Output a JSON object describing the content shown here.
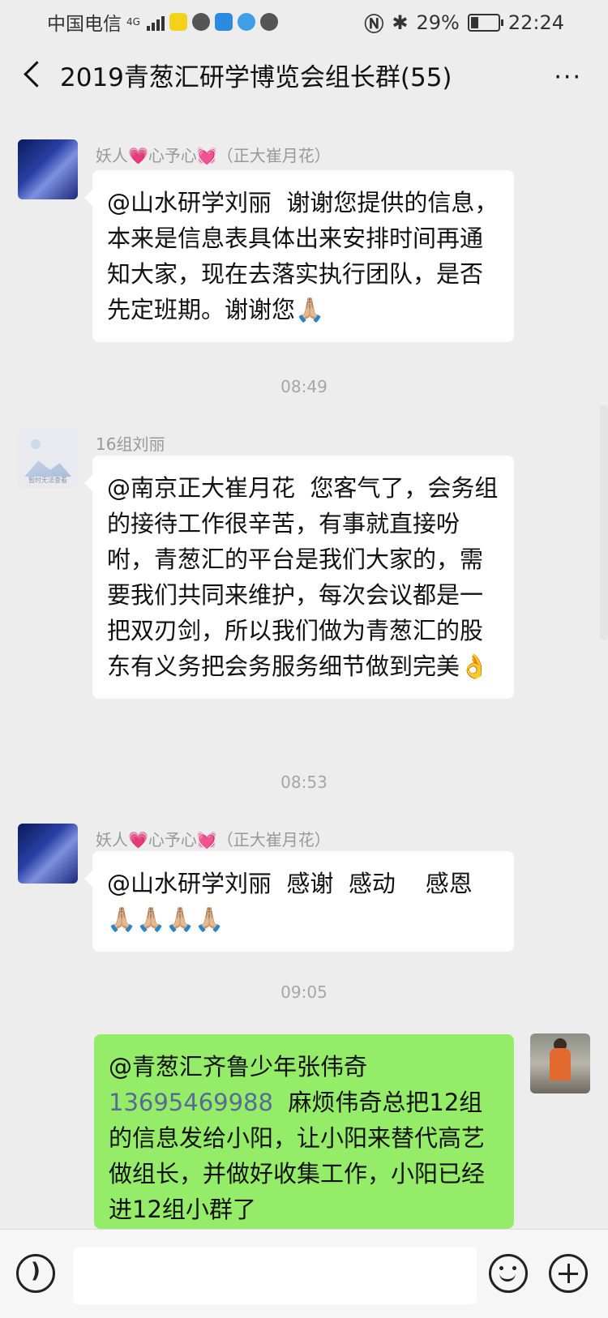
{
  "status_bar": {
    "carrier": "中国电信",
    "network": "4G",
    "battery_percent": "29%",
    "time": "22:24"
  },
  "header": {
    "title": "2019青葱汇研学博览会组长群(55)",
    "more_label": "···"
  },
  "messages": [
    {
      "sender": "妖人💗心予心💓（正大崔月花）",
      "text": "@山水研学刘丽  谢谢您提供的信息，本来是信息表具体出来安排时间再通知大家，现在去落实执行团队，是否先定班期。谢谢您🙏🏼",
      "side": "left",
      "avatar": "landscape-icon"
    },
    {
      "time": "08:49"
    },
    {
      "sender": "16组刘丽",
      "avatar_caption": "暂时无法查看",
      "text": "@南京正大崔月花  您客气了，会务组的接待工作很辛苦，有事就直接吩咐，青葱汇的平台是我们大家的，需要我们共同来维护，每次会议都是一把双刃剑，所以我们做为青葱汇的股东有义务把会务服务细节做到完美👌",
      "side": "left"
    },
    {
      "time": "08:53"
    },
    {
      "sender": "妖人💗心予心💓（正大崔月花）",
      "text": "@山水研学刘丽  感谢  感动    感恩🙏🏼🙏🏼🙏🏼🙏🏼",
      "side": "left"
    },
    {
      "time": "09:05"
    },
    {
      "text_before": "@青葱汇齐鲁少年张伟奇 ",
      "phone": "13695469988",
      "text_after": "  麻烦伟奇总把12组的信息发给小阳，让小阳来替代高艺做组长，并做好收集工作，小阳已经进12组小群了",
      "side": "right"
    }
  ],
  "input_bar": {
    "placeholder": "",
    "voice_icon": "voice-icon",
    "emoji_icon": "emoji-icon",
    "plus_icon": "plus-icon"
  }
}
